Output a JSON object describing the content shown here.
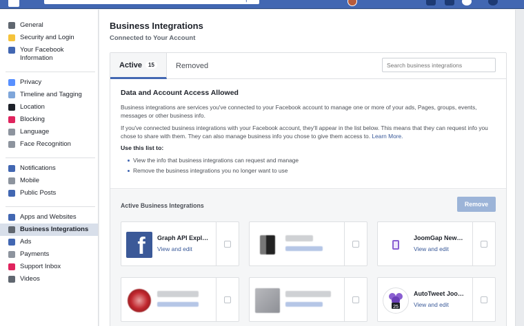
{
  "sidebar": {
    "groups": [
      [
        {
          "label": "General",
          "icon": "gears-icon",
          "color": "#606770"
        },
        {
          "label": "Security and Login",
          "icon": "shield-icon",
          "color": "#f5c33b"
        },
        {
          "label": "Your Facebook Information",
          "icon": "facebook-f-icon",
          "color": "#4267b2"
        }
      ],
      [
        {
          "label": "Privacy",
          "icon": "lock-icon",
          "color": "#5890ff"
        },
        {
          "label": "Timeline and Tagging",
          "icon": "timeline-icon",
          "color": "#7fa6da"
        },
        {
          "label": "Location",
          "icon": "location-icon",
          "color": "#1d2129"
        },
        {
          "label": "Blocking",
          "icon": "block-icon",
          "color": "#e0245e"
        },
        {
          "label": "Language",
          "icon": "language-icon",
          "color": "#8d949e"
        },
        {
          "label": "Face Recognition",
          "icon": "face-icon",
          "color": "#8d949e"
        }
      ],
      [
        {
          "label": "Notifications",
          "icon": "globe-icon",
          "color": "#4267b2"
        },
        {
          "label": "Mobile",
          "icon": "mobile-icon",
          "color": "#8d949e"
        },
        {
          "label": "Public Posts",
          "icon": "rss-icon",
          "color": "#4267b2"
        }
      ],
      [
        {
          "label": "Apps and Websites",
          "icon": "apps-icon",
          "color": "#4267b2"
        },
        {
          "label": "Business Integrations",
          "icon": "gear-icon",
          "color": "#606770",
          "active": true
        },
        {
          "label": "Ads",
          "icon": "ads-icon",
          "color": "#4267b2"
        },
        {
          "label": "Payments",
          "icon": "payments-icon",
          "color": "#8d949e"
        },
        {
          "label": "Support Inbox",
          "icon": "lifebuoy-icon",
          "color": "#e0245e"
        },
        {
          "label": "Videos",
          "icon": "film-icon",
          "color": "#606770"
        }
      ]
    ]
  },
  "header": {
    "title": "Business Integrations",
    "subtitle": "Connected to Your Account"
  },
  "tabs": {
    "active_label": "Active",
    "active_count": "15",
    "removed_label": "Removed",
    "search_placeholder": "Search business integrations"
  },
  "info": {
    "heading": "Data and Account Access Allowed",
    "para1": "Business integrations are services you've connected to your Facebook account to manage one or more of your ads, Pages, groups, events, messages or other business info.",
    "para2": "If you've connected business integrations with your Facebook account, they'll appear in the list below. This means that they can request info you chose to share with them. They can also manage business info you chose to give them access to.",
    "learn_more": "Learn More.",
    "use_title": "Use this list to:",
    "bullets": [
      "View the info that business integrations can request and manage",
      "Remove the business integrations you no longer want to use"
    ]
  },
  "list": {
    "header": "Active Business Integrations",
    "remove_label": "Remove",
    "apps": [
      {
        "name": "Graph API Expl…",
        "link": "View and edit",
        "icon": "facebook-logo-icon"
      },
      {
        "name": "",
        "link": "",
        "icon": "blurred-app-icon"
      },
      {
        "name": "JoomGap New…",
        "link": "View and edit",
        "icon": "mobile-app-icon"
      },
      {
        "name": "",
        "link": "",
        "icon": "blurred-app-icon"
      },
      {
        "name": "",
        "link": "",
        "icon": "blurred-app-icon"
      },
      {
        "name": "AutoTweet Joo…",
        "link": "View and edit",
        "icon": "autotweet-icon"
      }
    ]
  },
  "colors": {
    "brand": "#4267b2",
    "link": "#385898",
    "remove_disabled": "#9cb4d8"
  }
}
